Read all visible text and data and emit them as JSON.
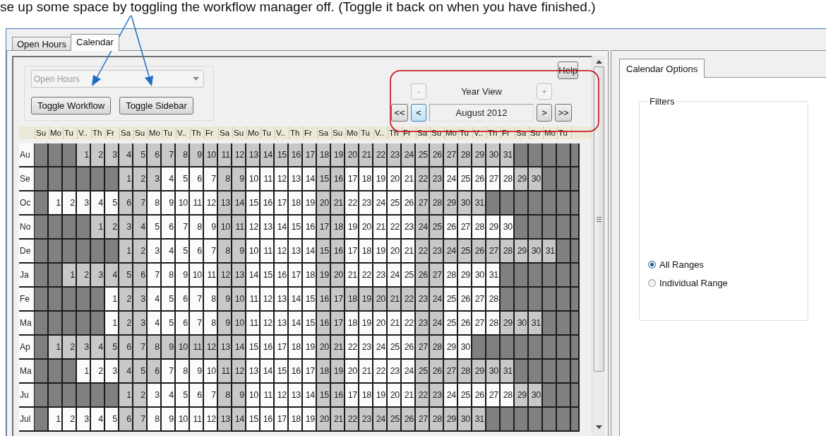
{
  "caption": "se up some space by toggling the workflow manager off. (Toggle it back on when you have finished.)",
  "tabs": [
    {
      "label": "Open Hours",
      "selected": false
    },
    {
      "label": "Calendar",
      "selected": true
    }
  ],
  "calendar": {
    "view_selector": {
      "value": "Open Hours",
      "disabled": true
    },
    "buttons": [
      "Toggle Workflow",
      "Toggle Sidebar"
    ],
    "help": "Help",
    "zoom_out": {
      "label": "-",
      "disabled": true
    },
    "view_label": "Year View",
    "zoom_in": {
      "label": "+",
      "disabled": true
    },
    "nav_left": [
      {
        "label": "<<",
        "focused": false
      },
      {
        "label": "<",
        "focused": true
      }
    ],
    "period": "August 2012",
    "nav_right": [
      {
        "label": ">",
        "focused": false
      },
      {
        "label": ">>",
        "focused": false
      }
    ],
    "weekdays": [
      "Su",
      "Mo",
      "Tu",
      "V..",
      "Th",
      "Fr",
      "Sa",
      "Su",
      "Mo",
      "Tu",
      "V..",
      "Th",
      "Fr",
      "Sa",
      "Su",
      "Mo",
      "Tu",
      "V..",
      "Th",
      "Fr",
      "Sa",
      "Su",
      "Mo",
      "Tu",
      "V..",
      "Th",
      "Fr",
      "Sa",
      "Su",
      "Mo",
      "Tu",
      "V..",
      "Th",
      "Fr",
      "Sa",
      "Su",
      "Mo",
      "Tu"
    ],
    "months": [
      {
        "label": "Au",
        "leading": [
          {
            "kind": "blank"
          },
          {
            "kind": "blank"
          },
          {
            "kind": "blank"
          }
        ],
        "days": [
          {
            "day": "1",
            "shaded": true
          },
          {
            "day": "2",
            "shaded": true
          },
          {
            "day": "3",
            "shaded": true
          },
          {
            "day": "4",
            "shaded": true
          },
          {
            "day": "5",
            "shaded": true
          },
          {
            "day": "6",
            "shaded": true
          },
          {
            "day": "7",
            "shaded": true
          },
          {
            "day": "8",
            "shaded": true
          },
          {
            "day": "9",
            "shaded": true
          },
          {
            "day": "10",
            "shaded": true
          },
          {
            "day": "11",
            "shaded": true
          },
          {
            "day": "12",
            "shaded": true
          },
          {
            "day": "13",
            "shaded": true
          },
          {
            "day": "14",
            "shaded": true
          },
          {
            "day": "15",
            "shaded": true
          },
          {
            "day": "16",
            "shaded": true
          },
          {
            "day": "17",
            "shaded": true
          },
          {
            "day": "18",
            "shaded": true
          },
          {
            "day": "19",
            "shaded": true
          },
          {
            "day": "20",
            "shaded": true
          },
          {
            "day": "21",
            "shaded": true
          },
          {
            "day": "22",
            "shaded": true
          },
          {
            "day": "23",
            "shaded": true
          },
          {
            "day": "24",
            "shaded": true
          },
          {
            "day": "25",
            "shaded": true
          },
          {
            "day": "26",
            "shaded": true
          },
          {
            "day": "27",
            "shaded": true
          },
          {
            "day": "28",
            "shaded": true
          },
          {
            "day": "29",
            "shaded": true
          },
          {
            "day": "30",
            "shaded": true
          },
          {
            "day": "31",
            "shaded": true
          }
        ]
      },
      {
        "label": "Se",
        "leading": [
          {
            "kind": "blank"
          },
          {
            "kind": "blank"
          },
          {
            "kind": "blank"
          },
          {
            "kind": "blank"
          },
          {
            "kind": "blank"
          },
          {
            "kind": "blank"
          }
        ],
        "days": [
          {
            "day": "1",
            "shaded": true
          },
          {
            "day": "2",
            "shaded": true
          },
          {
            "day": "3",
            "shaded": true
          },
          {
            "day": "4",
            "shaded": false
          },
          {
            "day": "5",
            "shaded": false
          },
          {
            "day": "6",
            "shaded": false
          },
          {
            "day": "7",
            "shaded": false
          },
          {
            "day": "8",
            "shaded": true
          },
          {
            "day": "9",
            "shaded": true
          },
          {
            "day": "10",
            "shaded": false
          },
          {
            "day": "11",
            "shaded": false
          },
          {
            "day": "12",
            "shaded": false
          },
          {
            "day": "13",
            "shaded": false
          },
          {
            "day": "14",
            "shaded": false
          },
          {
            "day": "15",
            "shaded": true
          },
          {
            "day": "16",
            "shaded": true
          },
          {
            "day": "17",
            "shaded": false
          },
          {
            "day": "18",
            "shaded": false
          },
          {
            "day": "19",
            "shaded": false
          },
          {
            "day": "20",
            "shaded": false
          },
          {
            "day": "21",
            "shaded": false
          },
          {
            "day": "22",
            "shaded": true
          },
          {
            "day": "23",
            "shaded": true
          },
          {
            "day": "24",
            "shaded": false
          },
          {
            "day": "25",
            "shaded": false
          },
          {
            "day": "26",
            "shaded": false
          },
          {
            "day": "27",
            "shaded": false
          },
          {
            "day": "28",
            "shaded": false
          },
          {
            "day": "29",
            "shaded": true
          },
          {
            "day": "30",
            "shaded": true
          }
        ]
      },
      {
        "label": "Oc",
        "leading": [
          {
            "kind": "blank"
          }
        ],
        "days": [
          {
            "day": "1",
            "shaded": false
          },
          {
            "day": "2",
            "shaded": false
          },
          {
            "day": "3",
            "shaded": false
          },
          {
            "day": "4",
            "shaded": false
          },
          {
            "day": "5",
            "shaded": false
          },
          {
            "day": "6",
            "shaded": true
          },
          {
            "day": "7",
            "shaded": true
          },
          {
            "day": "8",
            "shaded": false
          },
          {
            "day": "9",
            "shaded": false
          },
          {
            "day": "10",
            "shaded": false
          },
          {
            "day": "11",
            "shaded": false
          },
          {
            "day": "12",
            "shaded": false
          },
          {
            "day": "13",
            "shaded": true
          },
          {
            "day": "14",
            "shaded": true
          },
          {
            "day": "15",
            "shaded": false
          },
          {
            "day": "16",
            "shaded": false
          },
          {
            "day": "17",
            "shaded": false
          },
          {
            "day": "18",
            "shaded": false
          },
          {
            "day": "19",
            "shaded": false
          },
          {
            "day": "20",
            "shaded": true
          },
          {
            "day": "21",
            "shaded": true
          },
          {
            "day": "22",
            "shaded": false
          },
          {
            "day": "23",
            "shaded": false
          },
          {
            "day": "24",
            "shaded": false
          },
          {
            "day": "25",
            "shaded": false
          },
          {
            "day": "26",
            "shaded": false
          },
          {
            "day": "27",
            "shaded": true
          },
          {
            "day": "28",
            "shaded": true
          },
          {
            "day": "29",
            "shaded": true
          },
          {
            "day": "30",
            "shaded": true
          },
          {
            "day": "31",
            "shaded": true
          }
        ]
      },
      {
        "label": "No",
        "leading": [
          {
            "kind": "blank"
          },
          {
            "kind": "blank"
          },
          {
            "kind": "blank"
          },
          {
            "kind": "blank"
          }
        ],
        "days": [
          {
            "day": "1",
            "shaded": true
          },
          {
            "day": "2",
            "shaded": true
          },
          {
            "day": "3",
            "shaded": true
          },
          {
            "day": "4",
            "shaded": true
          },
          {
            "day": "5",
            "shaded": false
          },
          {
            "day": "6",
            "shaded": false
          },
          {
            "day": "7",
            "shaded": false
          },
          {
            "day": "8",
            "shaded": false
          },
          {
            "day": "9",
            "shaded": false
          },
          {
            "day": "10",
            "shaded": true
          },
          {
            "day": "11",
            "shaded": true
          },
          {
            "day": "12",
            "shaded": false
          },
          {
            "day": "13",
            "shaded": false
          },
          {
            "day": "14",
            "shaded": false
          },
          {
            "day": "15",
            "shaded": false
          },
          {
            "day": "16",
            "shaded": false
          },
          {
            "day": "17",
            "shaded": true
          },
          {
            "day": "18",
            "shaded": true
          },
          {
            "day": "19",
            "shaded": false
          },
          {
            "day": "20",
            "shaded": false
          },
          {
            "day": "21",
            "shaded": false
          },
          {
            "day": "22",
            "shaded": false
          },
          {
            "day": "23",
            "shaded": false
          },
          {
            "day": "24",
            "shaded": true
          },
          {
            "day": "25",
            "shaded": true
          },
          {
            "day": "26",
            "shaded": false
          },
          {
            "day": "27",
            "shaded": false
          },
          {
            "day": "28",
            "shaded": false
          },
          {
            "day": "29",
            "shaded": false
          },
          {
            "day": "30",
            "shaded": false
          }
        ]
      },
      {
        "label": "De",
        "leading": [
          {
            "kind": "blank"
          },
          {
            "kind": "blank"
          },
          {
            "kind": "blank"
          },
          {
            "kind": "blank"
          },
          {
            "kind": "blank"
          },
          {
            "kind": "blank"
          }
        ],
        "days": [
          {
            "day": "1",
            "shaded": true
          },
          {
            "day": "2",
            "shaded": true
          },
          {
            "day": "3",
            "shaded": false
          },
          {
            "day": "4",
            "shaded": false
          },
          {
            "day": "5",
            "shaded": false
          },
          {
            "day": "6",
            "shaded": false
          },
          {
            "day": "7",
            "shaded": false
          },
          {
            "day": "8",
            "shaded": true
          },
          {
            "day": "9",
            "shaded": true
          },
          {
            "day": "10",
            "shaded": false
          },
          {
            "day": "11",
            "shaded": false
          },
          {
            "day": "12",
            "shaded": false
          },
          {
            "day": "13",
            "shaded": false
          },
          {
            "day": "14",
            "shaded": false
          },
          {
            "day": "15",
            "shaded": true
          },
          {
            "day": "16",
            "shaded": true
          },
          {
            "day": "17",
            "shaded": false
          },
          {
            "day": "18",
            "shaded": false
          },
          {
            "day": "19",
            "shaded": false
          },
          {
            "day": "20",
            "shaded": false
          },
          {
            "day": "21",
            "shaded": false
          },
          {
            "day": "22",
            "shaded": true
          },
          {
            "day": "23",
            "shaded": true
          },
          {
            "day": "24",
            "shaded": true
          },
          {
            "day": "25",
            "shaded": true
          },
          {
            "day": "26",
            "shaded": true
          },
          {
            "day": "27",
            "shaded": true
          },
          {
            "day": "28",
            "shaded": true
          },
          {
            "day": "29",
            "shaded": true
          },
          {
            "day": "30",
            "shaded": true
          },
          {
            "day": "31",
            "shaded": true
          }
        ]
      },
      {
        "label": "Ja",
        "leading": [
          {
            "kind": "blank"
          },
          {
            "kind": "blank"
          }
        ],
        "days": [
          {
            "day": "1",
            "shaded": true
          },
          {
            "day": "2",
            "shaded": true
          },
          {
            "day": "3",
            "shaded": true
          },
          {
            "day": "4",
            "shaded": true
          },
          {
            "day": "5",
            "shaded": true
          },
          {
            "day": "6",
            "shaded": true
          },
          {
            "day": "7",
            "shaded": false
          },
          {
            "day": "8",
            "shaded": false
          },
          {
            "day": "9",
            "shaded": false
          },
          {
            "day": "10",
            "shaded": false
          },
          {
            "day": "11",
            "shaded": false
          },
          {
            "day": "12",
            "shaded": true
          },
          {
            "day": "13",
            "shaded": true
          },
          {
            "day": "14",
            "shaded": false
          },
          {
            "day": "15",
            "shaded": false
          },
          {
            "day": "16",
            "shaded": false
          },
          {
            "day": "17",
            "shaded": false
          },
          {
            "day": "18",
            "shaded": false
          },
          {
            "day": "19",
            "shaded": true
          },
          {
            "day": "20",
            "shaded": true
          },
          {
            "day": "21",
            "shaded": false
          },
          {
            "day": "22",
            "shaded": false
          },
          {
            "day": "23",
            "shaded": false
          },
          {
            "day": "24",
            "shaded": false
          },
          {
            "day": "25",
            "shaded": false
          },
          {
            "day": "26",
            "shaded": true
          },
          {
            "day": "27",
            "shaded": true
          },
          {
            "day": "28",
            "shaded": false
          },
          {
            "day": "29",
            "shaded": false
          },
          {
            "day": "30",
            "shaded": false
          },
          {
            "day": "31",
            "shaded": false
          }
        ]
      },
      {
        "label": "Fe",
        "leading": [
          {
            "kind": "blank"
          },
          {
            "kind": "blank"
          },
          {
            "kind": "blank"
          },
          {
            "kind": "blank"
          },
          {
            "kind": "blank"
          }
        ],
        "days": [
          {
            "day": "1",
            "shaded": false
          },
          {
            "day": "2",
            "shaded": true
          },
          {
            "day": "3",
            "shaded": true
          },
          {
            "day": "4",
            "shaded": false
          },
          {
            "day": "5",
            "shaded": false
          },
          {
            "day": "6",
            "shaded": false
          },
          {
            "day": "7",
            "shaded": false
          },
          {
            "day": "8",
            "shaded": false
          },
          {
            "day": "9",
            "shaded": true
          },
          {
            "day": "10",
            "shaded": true
          },
          {
            "day": "11",
            "shaded": false
          },
          {
            "day": "12",
            "shaded": false
          },
          {
            "day": "13",
            "shaded": false
          },
          {
            "day": "14",
            "shaded": false
          },
          {
            "day": "15",
            "shaded": false
          },
          {
            "day": "16",
            "shaded": true
          },
          {
            "day": "17",
            "shaded": true
          },
          {
            "day": "18",
            "shaded": true
          },
          {
            "day": "19",
            "shaded": true
          },
          {
            "day": "20",
            "shaded": true
          },
          {
            "day": "21",
            "shaded": true
          },
          {
            "day": "22",
            "shaded": true
          },
          {
            "day": "23",
            "shaded": true
          },
          {
            "day": "24",
            "shaded": true
          },
          {
            "day": "25",
            "shaded": false
          },
          {
            "day": "26",
            "shaded": false
          },
          {
            "day": "27",
            "shaded": false
          },
          {
            "day": "28",
            "shaded": false
          }
        ]
      },
      {
        "label": "Ma",
        "leading": [
          {
            "kind": "blank"
          },
          {
            "kind": "blank"
          },
          {
            "kind": "blank"
          },
          {
            "kind": "blank"
          },
          {
            "kind": "blank"
          }
        ],
        "days": [
          {
            "day": "1",
            "shaded": false
          },
          {
            "day": "2",
            "shaded": true
          },
          {
            "day": "3",
            "shaded": true
          },
          {
            "day": "4",
            "shaded": false
          },
          {
            "day": "5",
            "shaded": false
          },
          {
            "day": "6",
            "shaded": false
          },
          {
            "day": "7",
            "shaded": false
          },
          {
            "day": "8",
            "shaded": false
          },
          {
            "day": "9",
            "shaded": true
          },
          {
            "day": "10",
            "shaded": true
          },
          {
            "day": "11",
            "shaded": false
          },
          {
            "day": "12",
            "shaded": false
          },
          {
            "day": "13",
            "shaded": false
          },
          {
            "day": "14",
            "shaded": false
          },
          {
            "day": "15",
            "shaded": false
          },
          {
            "day": "16",
            "shaded": true
          },
          {
            "day": "17",
            "shaded": true
          },
          {
            "day": "18",
            "shaded": false
          },
          {
            "day": "19",
            "shaded": false
          },
          {
            "day": "20",
            "shaded": false
          },
          {
            "day": "21",
            "shaded": false
          },
          {
            "day": "22",
            "shaded": false
          },
          {
            "day": "23",
            "shaded": true
          },
          {
            "day": "24",
            "shaded": true
          },
          {
            "day": "25",
            "shaded": false
          },
          {
            "day": "26",
            "shaded": false
          },
          {
            "day": "27",
            "shaded": false
          },
          {
            "day": "28",
            "shaded": false
          },
          {
            "day": "29",
            "shaded": true
          },
          {
            "day": "30",
            "shaded": true
          },
          {
            "day": "31",
            "shaded": true
          }
        ]
      },
      {
        "label": "Ap",
        "leading": [
          {
            "kind": "blank"
          }
        ],
        "days": [
          {
            "day": "1",
            "shaded": true
          },
          {
            "day": "2",
            "shaded": true
          },
          {
            "day": "3",
            "shaded": true
          },
          {
            "day": "4",
            "shaded": true
          },
          {
            "day": "5",
            "shaded": true
          },
          {
            "day": "6",
            "shaded": true
          },
          {
            "day": "7",
            "shaded": true
          },
          {
            "day": "8",
            "shaded": true
          },
          {
            "day": "9",
            "shaded": true
          },
          {
            "day": "10",
            "shaded": true
          },
          {
            "day": "11",
            "shaded": true
          },
          {
            "day": "12",
            "shaded": true
          },
          {
            "day": "13",
            "shaded": true
          },
          {
            "day": "14",
            "shaded": true
          },
          {
            "day": "15",
            "shaded": false
          },
          {
            "day": "16",
            "shaded": false
          },
          {
            "day": "17",
            "shaded": false
          },
          {
            "day": "18",
            "shaded": false
          },
          {
            "day": "19",
            "shaded": false
          },
          {
            "day": "20",
            "shaded": true
          },
          {
            "day": "21",
            "shaded": true
          },
          {
            "day": "22",
            "shaded": false
          },
          {
            "day": "23",
            "shaded": false
          },
          {
            "day": "24",
            "shaded": false
          },
          {
            "day": "25",
            "shaded": false
          },
          {
            "day": "26",
            "shaded": false
          },
          {
            "day": "27",
            "shaded": true
          },
          {
            "day": "28",
            "shaded": true
          },
          {
            "day": "29",
            "shaded": false
          },
          {
            "day": "30",
            "shaded": false
          }
        ]
      },
      {
        "label": "Ma",
        "leading": [
          {
            "kind": "blank"
          },
          {
            "kind": "blank"
          },
          {
            "kind": "blank"
          }
        ],
        "days": [
          {
            "day": "1",
            "shaded": false
          },
          {
            "day": "2",
            "shaded": false
          },
          {
            "day": "3",
            "shaded": false
          },
          {
            "day": "4",
            "shaded": true
          },
          {
            "day": "5",
            "shaded": true
          },
          {
            "day": "6",
            "shaded": true
          },
          {
            "day": "7",
            "shaded": false
          },
          {
            "day": "8",
            "shaded": false
          },
          {
            "day": "9",
            "shaded": false
          },
          {
            "day": "10",
            "shaded": false
          },
          {
            "day": "11",
            "shaded": true
          },
          {
            "day": "12",
            "shaded": true
          },
          {
            "day": "13",
            "shaded": false
          },
          {
            "day": "14",
            "shaded": false
          },
          {
            "day": "15",
            "shaded": false
          },
          {
            "day": "16",
            "shaded": false
          },
          {
            "day": "17",
            "shaded": false
          },
          {
            "day": "18",
            "shaded": true
          },
          {
            "day": "19",
            "shaded": true
          },
          {
            "day": "20",
            "shaded": false
          },
          {
            "day": "21",
            "shaded": false
          },
          {
            "day": "22",
            "shaded": false
          },
          {
            "day": "23",
            "shaded": false
          },
          {
            "day": "24",
            "shaded": false
          },
          {
            "day": "25",
            "shaded": true
          },
          {
            "day": "26",
            "shaded": true
          },
          {
            "day": "27",
            "shaded": true
          },
          {
            "day": "28",
            "shaded": true
          },
          {
            "day": "29",
            "shaded": true
          },
          {
            "day": "30",
            "shaded": true
          },
          {
            "day": "31",
            "shaded": true
          }
        ]
      },
      {
        "label": "Ju",
        "leading": [
          {
            "kind": "blank"
          },
          {
            "kind": "blank"
          },
          {
            "kind": "blank"
          },
          {
            "kind": "blank"
          },
          {
            "kind": "blank"
          },
          {
            "kind": "blank"
          }
        ],
        "days": [
          {
            "day": "1",
            "shaded": true
          },
          {
            "day": "2",
            "shaded": true
          },
          {
            "day": "3",
            "shaded": false
          },
          {
            "day": "4",
            "shaded": false
          },
          {
            "day": "5",
            "shaded": false
          },
          {
            "day": "6",
            "shaded": false
          },
          {
            "day": "7",
            "shaded": false
          },
          {
            "day": "8",
            "shaded": true
          },
          {
            "day": "9",
            "shaded": true
          },
          {
            "day": "10",
            "shaded": false
          },
          {
            "day": "11",
            "shaded": false
          },
          {
            "day": "12",
            "shaded": false
          },
          {
            "day": "13",
            "shaded": false
          },
          {
            "day": "14",
            "shaded": false
          },
          {
            "day": "15",
            "shaded": true
          },
          {
            "day": "16",
            "shaded": true
          },
          {
            "day": "17",
            "shaded": false
          },
          {
            "day": "18",
            "shaded": false
          },
          {
            "day": "19",
            "shaded": false
          },
          {
            "day": "20",
            "shaded": false
          },
          {
            "day": "21",
            "shaded": false
          },
          {
            "day": "22",
            "shaded": true
          },
          {
            "day": "23",
            "shaded": true
          },
          {
            "day": "24",
            "shaded": false
          },
          {
            "day": "25",
            "shaded": false
          },
          {
            "day": "26",
            "shaded": false
          },
          {
            "day": "27",
            "shaded": false
          },
          {
            "day": "28",
            "shaded": false
          },
          {
            "day": "29",
            "shaded": true
          },
          {
            "day": "30",
            "shaded": true
          }
        ]
      },
      {
        "label": "Jul",
        "leading": [
          {
            "kind": "blank"
          }
        ],
        "days": [
          {
            "day": "1",
            "shaded": false
          },
          {
            "day": "2",
            "shaded": false
          },
          {
            "day": "3",
            "shaded": false
          },
          {
            "day": "4",
            "shaded": false
          },
          {
            "day": "5",
            "shaded": false
          },
          {
            "day": "6",
            "shaded": true
          },
          {
            "day": "7",
            "shaded": true
          },
          {
            "day": "8",
            "shaded": false
          },
          {
            "day": "9",
            "shaded": false
          },
          {
            "day": "10",
            "shaded": false
          },
          {
            "day": "11",
            "shaded": false
          },
          {
            "day": "12",
            "shaded": false
          },
          {
            "day": "13",
            "shaded": true
          },
          {
            "day": "14",
            "shaded": true
          },
          {
            "day": "15",
            "shaded": false
          },
          {
            "day": "16",
            "shaded": false
          },
          {
            "day": "17",
            "shaded": false
          },
          {
            "day": "18",
            "shaded": false
          },
          {
            "day": "19",
            "shaded": false
          },
          {
            "day": "20",
            "shaded": true
          },
          {
            "day": "21",
            "shaded": true
          },
          {
            "day": "22",
            "shaded": true
          },
          {
            "day": "23",
            "shaded": true
          },
          {
            "day": "24",
            "shaded": true
          },
          {
            "day": "25",
            "shaded": true
          },
          {
            "day": "26",
            "shaded": true
          },
          {
            "day": "27",
            "shaded": true
          },
          {
            "day": "28",
            "shaded": true
          },
          {
            "day": "29",
            "shaded": true
          },
          {
            "day": "30",
            "shaded": true
          },
          {
            "day": "31",
            "shaded": true
          }
        ]
      }
    ]
  },
  "sidebar": {
    "tabs": [
      {
        "label": "Calendar Options",
        "selected": true
      }
    ],
    "filters": {
      "title": "Filters",
      "options": [
        {
          "label": "All Ranges",
          "selected": true
        },
        {
          "label": "Individual Range",
          "selected": false
        }
      ]
    }
  }
}
